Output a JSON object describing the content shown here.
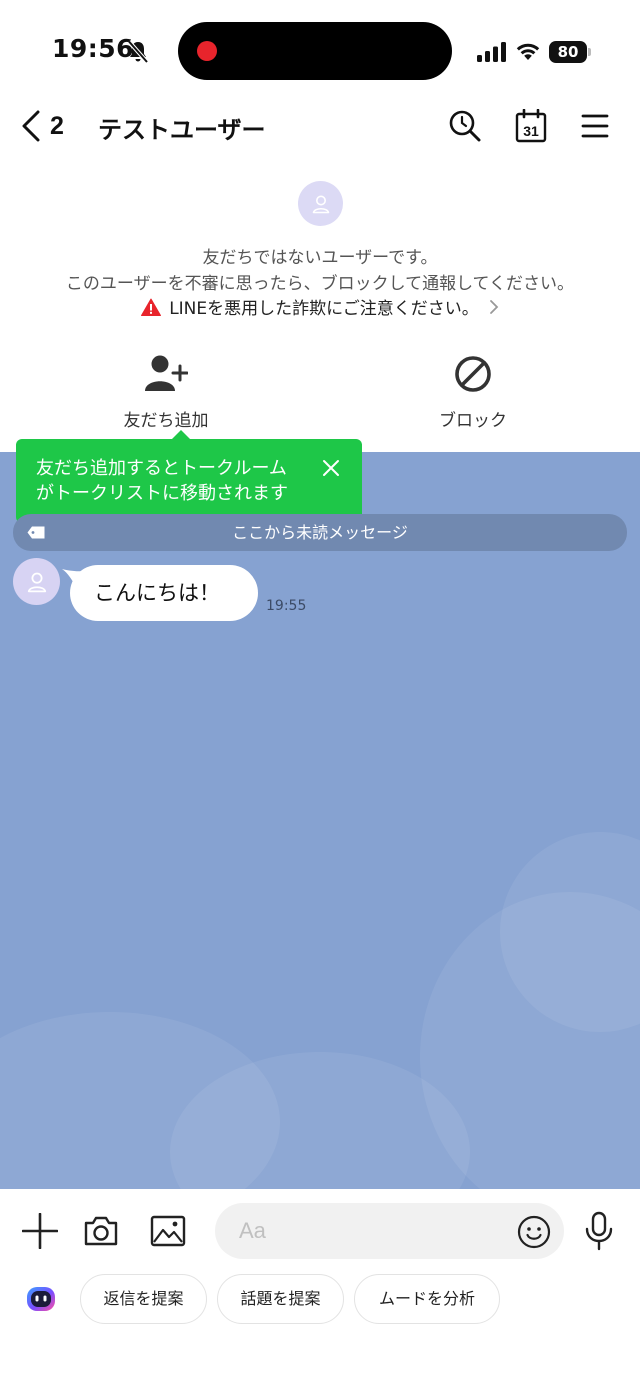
{
  "status_bar": {
    "time": "19:56",
    "battery_level": "80",
    "icons": [
      "bell-muted-icon",
      "recording-dot-icon",
      "signal-icon",
      "wifi-icon",
      "battery-icon"
    ]
  },
  "header": {
    "back_count": "2",
    "title": "テストユーザー",
    "icons": [
      "back-chevron-icon",
      "search-icon",
      "calendar-icon",
      "menu-icon"
    ],
    "calendar_day": "31"
  },
  "notice": {
    "line1": "友だちではないユーザーです。",
    "line2": "このユーザーを不審に思ったら、ブロックして通報してください。",
    "warning": "LINEを悪用した詐欺にご注意ください。",
    "add_friend_label": "友だち追加",
    "block_label": "ブロック"
  },
  "tooltip": {
    "line1": "友だち追加するとトークルーム",
    "line2": "がトークリストに移動されます"
  },
  "chat": {
    "unread_divider": "ここから未読メッセージ",
    "messages": [
      {
        "text": "こんにちは！",
        "time": "19:55"
      }
    ]
  },
  "input": {
    "placeholder": "Aa",
    "value": "",
    "icons": [
      "plus-icon",
      "camera-icon",
      "image-icon",
      "emoji-icon",
      "microphone-icon",
      "ai-assistant-icon"
    ]
  },
  "suggestions": [
    "返信を提案",
    "話題を提案",
    "ムードを分析"
  ],
  "colors": {
    "chat_background": "#86a2d1",
    "tooltip_green": "#1ec748",
    "warning_red": "#e8242c",
    "avatar_lavender": "#dcdaf5"
  }
}
